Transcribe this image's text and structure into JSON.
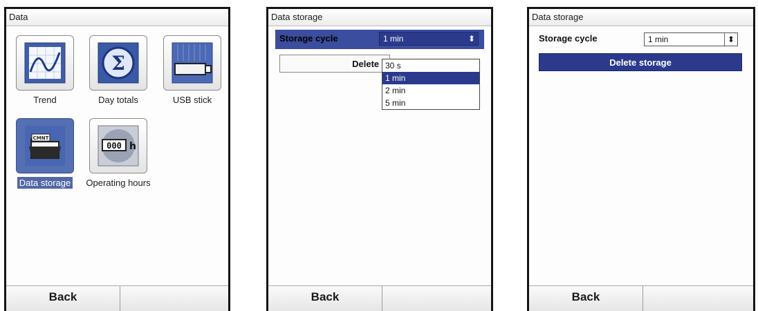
{
  "screen1": {
    "title": "Data",
    "tiles": [
      {
        "label": "Trend",
        "icon": "trend-icon"
      },
      {
        "label": "Day totals",
        "icon": "sigma-icon"
      },
      {
        "label": "USB stick",
        "icon": "usb-stick-icon"
      },
      {
        "label": "Data storage",
        "icon": "folder-icon",
        "selected": true
      },
      {
        "label": "Operating hours",
        "icon": "hour-counter-icon"
      }
    ],
    "softkeys": {
      "left": "Back",
      "right": ""
    }
  },
  "screen2": {
    "title": "Data storage",
    "row_label": "Storage cycle",
    "select_value": "1 min",
    "delete_label": "Delete s",
    "options": [
      "30 s",
      "1 min",
      "2 min",
      "5 min"
    ],
    "selected_option": "1 min",
    "softkeys": {
      "left": "Back",
      "right": ""
    }
  },
  "screen3": {
    "title": "Data storage",
    "row_label": "Storage cycle",
    "select_value": "1 min",
    "delete_label": "Delete storage",
    "softkeys": {
      "left": "Back",
      "right": ""
    }
  },
  "colors": {
    "highlight": "#2b3a8c",
    "tile_selected": "#5570b2",
    "frame": "#141414"
  }
}
